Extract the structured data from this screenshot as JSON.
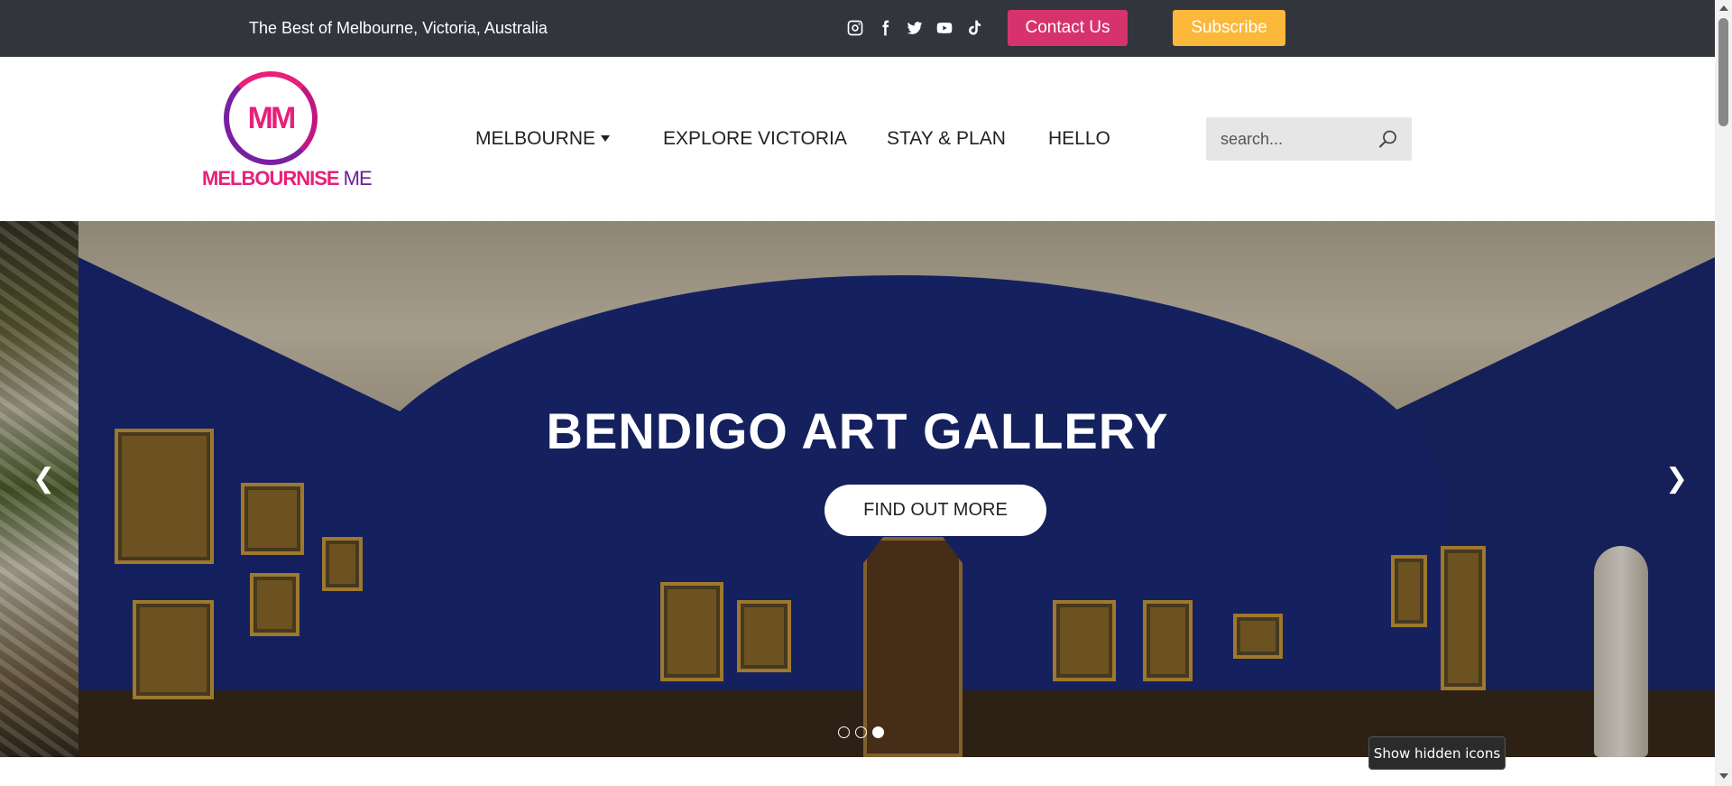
{
  "topbar": {
    "tagline": "The Best of Melbourne, Victoria, Australia",
    "socials": [
      "instagram-icon",
      "facebook-icon",
      "twitter-icon",
      "youtube-icon",
      "tiktok-icon"
    ],
    "contact_label": "Contact Us",
    "subscribe_label": "Subscribe",
    "colors": {
      "bar": "#32353c",
      "contact": "#d6336c",
      "subscribe": "#fcb83a"
    }
  },
  "header": {
    "logo": {
      "mark": "MM",
      "text_bold": "MELBOURNISE",
      "text_light": " ME"
    },
    "nav": [
      "MELBOURNE",
      "EXPLORE VICTORIA",
      "STAY & PLAN",
      "HELLO"
    ],
    "search": {
      "placeholder": "search..."
    }
  },
  "hero": {
    "title": "BENDIGO ART GALLERY",
    "cta_label": "FIND OUT MORE",
    "prev_arrow": "❮",
    "next_arrow": "❯",
    "slide_count": 3,
    "active_slide": 3
  },
  "tooltip": "Show hidden icons"
}
